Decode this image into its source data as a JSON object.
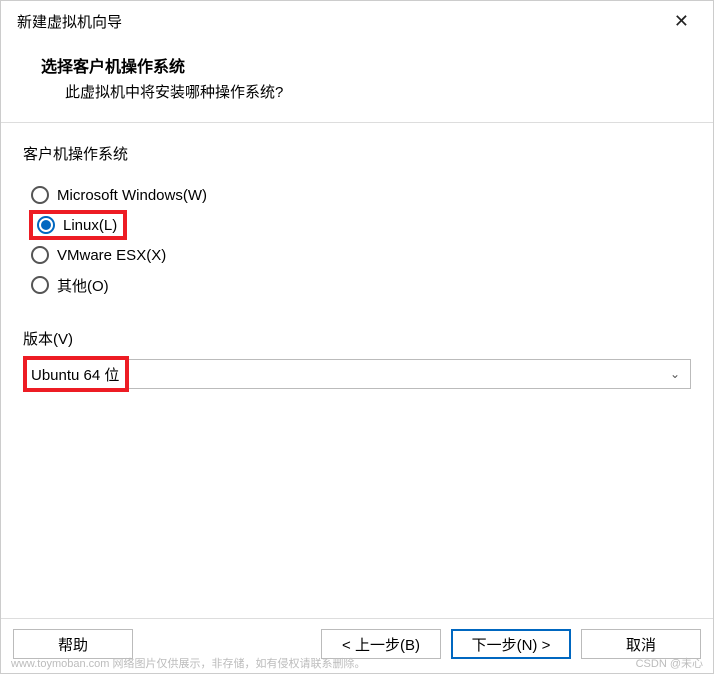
{
  "window": {
    "title": "新建虚拟机向导"
  },
  "header": {
    "title": "选择客户机操作系统",
    "subtitle": "此虚拟机中将安装哪种操作系统?"
  },
  "os_group": {
    "label": "客户机操作系统",
    "options": [
      {
        "label": "Microsoft Windows(W)",
        "selected": false
      },
      {
        "label": "Linux(L)",
        "selected": true
      },
      {
        "label": "VMware ESX(X)",
        "selected": false
      },
      {
        "label": "其他(O)",
        "selected": false
      }
    ]
  },
  "version": {
    "label": "版本(V)",
    "selected": "Ubuntu 64 位"
  },
  "buttons": {
    "help": "帮助",
    "back": "< 上一步(B)",
    "next": "下一步(N) >",
    "cancel": "取消"
  },
  "watermark": {
    "left": "www.toymoban.com  网络图片仅供展示，非存储，如有侵权请联系删除。",
    "right": "CSDN @未心"
  }
}
